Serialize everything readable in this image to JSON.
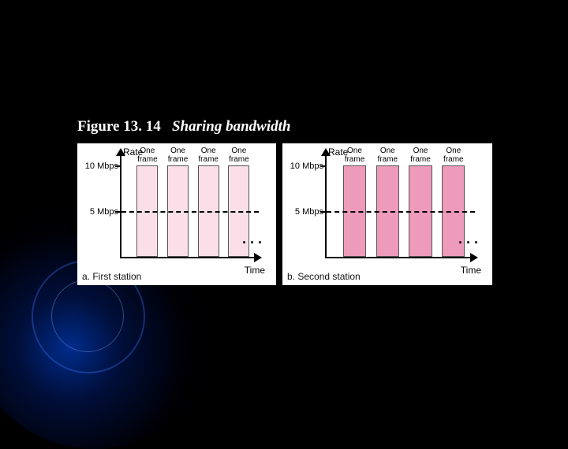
{
  "caption": {
    "figure": "Figure 13. 14",
    "title": "Sharing bandwidth"
  },
  "axes": {
    "ylabel": "Rate",
    "xlabel": "Time",
    "ticks": [
      {
        "value": 10,
        "label": "10 Mbps"
      },
      {
        "value": 5,
        "label": "5 Mbps"
      }
    ],
    "dashed_at": 5,
    "ellipsis": ". . ."
  },
  "bar_label": {
    "line1": "One",
    "line2": "frame"
  },
  "panels": [
    {
      "id": "a",
      "subcaption": "a. First station",
      "bar_count": 4,
      "bar_height_value": 10,
      "bar_color": "#fbdfe8"
    },
    {
      "id": "b",
      "subcaption": "b. Second station",
      "bar_count": 4,
      "bar_height_value": 10,
      "bar_color": "#ee9aba"
    }
  ],
  "chart_data": [
    {
      "type": "bar",
      "title": "a. First station",
      "xlabel": "Time",
      "ylabel": "Rate",
      "ylim": [
        0,
        10
      ],
      "categories": [
        "frame 1",
        "frame 2",
        "frame 3",
        "frame 4"
      ],
      "values": [
        10,
        10,
        10,
        10
      ],
      "reference_line": 5,
      "note": "Each bar represents one frame transmitted at 10 Mbps; dashed line marks 5 Mbps."
    },
    {
      "type": "bar",
      "title": "b. Second station",
      "xlabel": "Time",
      "ylabel": "Rate",
      "ylim": [
        0,
        10
      ],
      "categories": [
        "frame 1",
        "frame 2",
        "frame 3",
        "frame 4"
      ],
      "values": [
        10,
        10,
        10,
        10
      ],
      "reference_line": 5,
      "note": "Each bar represents one frame transmitted at 10 Mbps; dashed line marks 5 Mbps."
    }
  ]
}
